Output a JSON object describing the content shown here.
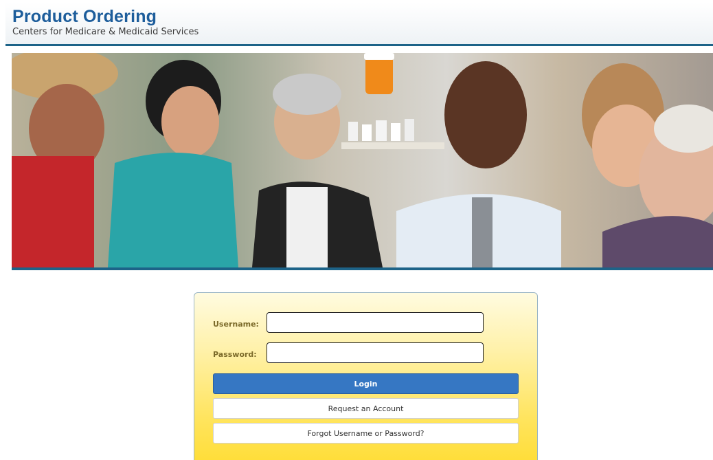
{
  "header": {
    "title": "Product Ordering",
    "subtitle": "Centers for Medicare & Medicaid Services"
  },
  "banner": {
    "image": "photo collage of patients, a nurse and a pharmacist"
  },
  "login": {
    "username_label": "Username:",
    "username_value": "",
    "password_label": "Password:",
    "password_value": "",
    "login_button": "Login",
    "request_account_button": "Request an Account",
    "forgot_button": "Forgot Username or Password?"
  },
  "colors": {
    "brand_blue": "#1d5d9b",
    "header_rule": "#1d6388",
    "login_button": "#3677c3",
    "login_panel_yellow": "#ffe45e"
  }
}
